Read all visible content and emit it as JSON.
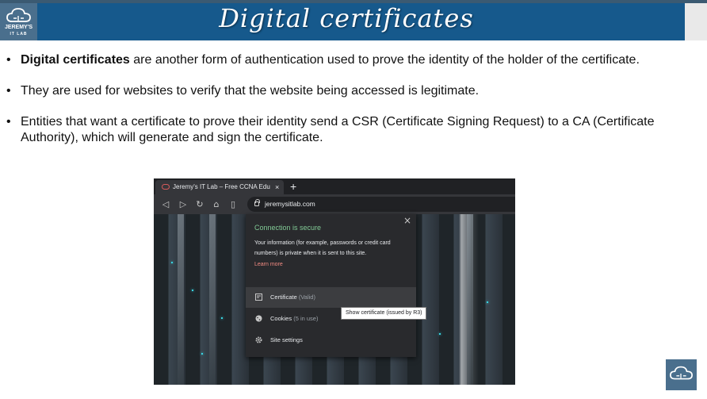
{
  "brand": {
    "logo_line1": "JEREMY'S",
    "logo_line2": "IT LAB"
  },
  "slide": {
    "title": "Digital certificates",
    "bullets": [
      {
        "bold": "Digital certificates",
        "text": " are another form of authentication used to prove the identity of the holder of the certificate."
      },
      {
        "bold": "",
        "text": "They are used for websites to verify that the website being accessed is legitimate."
      },
      {
        "bold": "",
        "text": "Entities that want a certificate to prove their identity send a CSR (Certificate Signing Request) to a CA (Certificate Authority), which will generate and sign the certificate."
      }
    ]
  },
  "browser": {
    "tab_title": "Jeremy's IT Lab – Free CCNA Edu",
    "tab_close": "×",
    "new_tab": "+",
    "nav_icons": [
      "back-icon",
      "forward-icon",
      "reload-icon",
      "home-icon",
      "bookmark-icon"
    ],
    "url": "jeremysitlab.com",
    "popup": {
      "close": "×",
      "status": "Connection is secure",
      "description": "Your information (for example, passwords or credit card numbers) is private when it is sent to this site.",
      "learn_more": "Learn more",
      "certificate_label": "Certificate",
      "certificate_status": "(Valid)",
      "cookies_label": "Cookies",
      "cookies_status": "(5 in use)",
      "site_settings_label": "Site settings"
    },
    "tooltip": "Show certificate (issued by R3)"
  },
  "colors": {
    "header_bg": "#16598c",
    "secure_green": "#81c995",
    "learn_more_red": "#f28b82",
    "popup_bg": "#292a2d"
  }
}
